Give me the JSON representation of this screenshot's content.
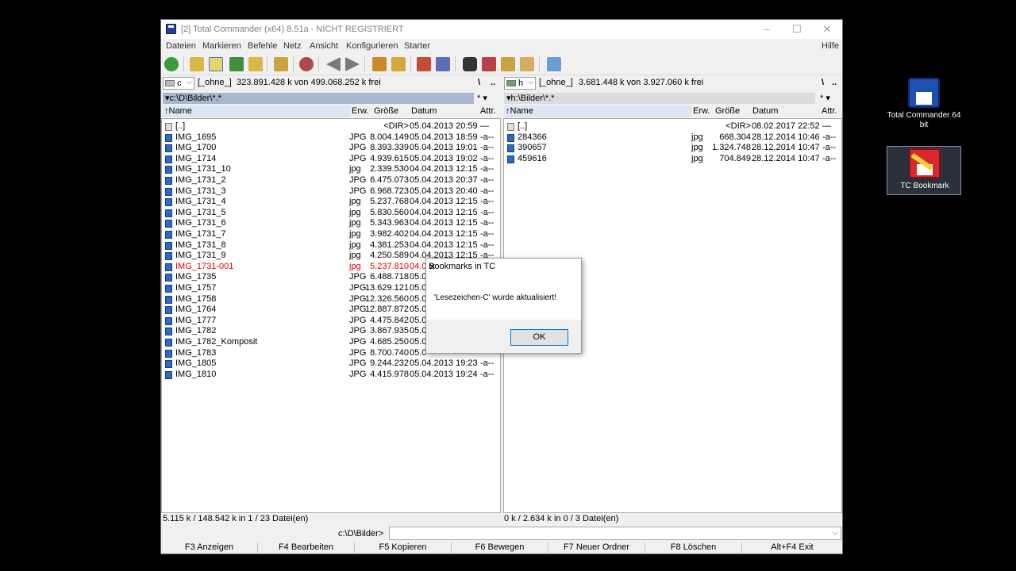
{
  "window": {
    "title": "[2] Total Commander (x64) 8.51a - NICHT REGISTRIERT",
    "controls": [
      "–",
      "☐",
      "✕"
    ]
  },
  "menu": [
    "Dateien",
    "Markieren",
    "Befehle",
    "Netz",
    "Ansicht",
    "Konfigurieren",
    "Starter"
  ],
  "menu_help": "Hilfe",
  "left": {
    "drive": "c",
    "volume": "[_ohne_]",
    "free": "323.891.428 k von 499.068.252 k frei",
    "root_btn": "\\",
    "up_btn": "..",
    "path": "▾c:\\D\\Bilder\\*.*",
    "path_tail": "* ▾",
    "headers": {
      "name": "↑Name",
      "ext": "Erw.",
      "size": "Größe",
      "date": "Datum",
      "attr": "Attr."
    },
    "files": [
      {
        "name": "[..]",
        "ext": "",
        "size": "<DIR>",
        "date": "05.04.2013 20:59",
        "attr": "—",
        "up": true
      },
      {
        "name": "IMG_1695",
        "ext": "JPG",
        "size": "8.004.149",
        "date": "05.04.2013 18:59",
        "attr": "-a--"
      },
      {
        "name": "IMG_1700",
        "ext": "JPG",
        "size": "8.393.339",
        "date": "05.04.2013 19:01",
        "attr": "-a--"
      },
      {
        "name": "IMG_1714",
        "ext": "JPG",
        "size": "4.939.615",
        "date": "05.04.2013 19:02",
        "attr": "-a--"
      },
      {
        "name": "IMG_1731_10",
        "ext": "jpg",
        "size": "2.339.530",
        "date": "04.04.2013 12:15",
        "attr": "-a--"
      },
      {
        "name": "IMG_1731_2",
        "ext": "JPG",
        "size": "6.475.073",
        "date": "05.04.2013 20:37",
        "attr": "-a--"
      },
      {
        "name": "IMG_1731_3",
        "ext": "JPG",
        "size": "6.968.723",
        "date": "05.04.2013 20:40",
        "attr": "-a--"
      },
      {
        "name": "IMG_1731_4",
        "ext": "jpg",
        "size": "5.237.768",
        "date": "04.04.2013 12:15",
        "attr": "-a--"
      },
      {
        "name": "IMG_1731_5",
        "ext": "jpg",
        "size": "5.830.560",
        "date": "04.04.2013 12:15",
        "attr": "-a--"
      },
      {
        "name": "IMG_1731_6",
        "ext": "jpg",
        "size": "5.343.963",
        "date": "04.04.2013 12:15",
        "attr": "-a--"
      },
      {
        "name": "IMG_1731_7",
        "ext": "jpg",
        "size": "3.982.402",
        "date": "04.04.2013 12:15",
        "attr": "-a--"
      },
      {
        "name": "IMG_1731_8",
        "ext": "jpg",
        "size": "4.381.253",
        "date": "04.04.2013 12:15",
        "attr": "-a--"
      },
      {
        "name": "IMG_1731_9",
        "ext": "jpg",
        "size": "4.250.589",
        "date": "04.04.2013 12:15",
        "attr": "-a--"
      },
      {
        "name": "IMG_1731-001",
        "ext": "jpg",
        "size": "5.237.810",
        "date": "04.0",
        "attr": "",
        "selected": true
      },
      {
        "name": "IMG_1735",
        "ext": "JPG",
        "size": "6.488.718",
        "date": "05.0",
        "attr": ""
      },
      {
        "name": "IMG_1757",
        "ext": "JPG",
        "size": "13.629.121",
        "date": "05.0",
        "attr": ""
      },
      {
        "name": "IMG_1758",
        "ext": "JPG",
        "size": "12.326.560",
        "date": "05.0",
        "attr": ""
      },
      {
        "name": "IMG_1764",
        "ext": "JPG",
        "size": "12.887.872",
        "date": "05.0",
        "attr": ""
      },
      {
        "name": "IMG_1777",
        "ext": "JPG",
        "size": "4.475.842",
        "date": "05.0",
        "attr": ""
      },
      {
        "name": "IMG_1782",
        "ext": "JPG",
        "size": "3.867.935",
        "date": "05.0",
        "attr": ""
      },
      {
        "name": "IMG_1782_Komposit",
        "ext": "JPG",
        "size": "4.685.250",
        "date": "05.0",
        "attr": ""
      },
      {
        "name": "IMG_1783",
        "ext": "JPG",
        "size": "8.700.740",
        "date": "05.0",
        "attr": ""
      },
      {
        "name": "IMG_1805",
        "ext": "JPG",
        "size": "9.244.232",
        "date": "05.04.2013 19:23",
        "attr": "-a--"
      },
      {
        "name": "IMG_1810",
        "ext": "JPG",
        "size": "4.415.978",
        "date": "05.04.2013 19:24",
        "attr": "-a--"
      }
    ],
    "status": "5.115 k / 148.542 k in 1 / 23 Datei(en)"
  },
  "right": {
    "drive": "h",
    "volume": "[_ohne_]",
    "free": "3.681.448 k von 3.927.060 k frei",
    "root_btn": "\\",
    "up_btn": "..",
    "path": "▾h:\\Bilder\\*.*",
    "path_tail": "* ▾",
    "headers": {
      "name": "↑Name",
      "ext": "Erw.",
      "size": "Größe",
      "date": "Datum",
      "attr": "Attr."
    },
    "files": [
      {
        "name": "[..]",
        "ext": "",
        "size": "<DIR>",
        "date": "08.02.2017 22:52",
        "attr": "—",
        "up": true
      },
      {
        "name": "284366",
        "ext": "jpg",
        "size": "668.304",
        "date": "28.12.2014 10:46",
        "attr": "-a--"
      },
      {
        "name": "390657",
        "ext": "jpg",
        "size": "1.324.748",
        "date": "28.12.2014 10:47",
        "attr": "-a--"
      },
      {
        "name": "459616",
        "ext": "jpg",
        "size": "704.849",
        "date": "28.12.2014 10:47",
        "attr": "-a--"
      }
    ],
    "status": "0 k / 2.634 k in 0 / 3 Datei(en)"
  },
  "cmdline": {
    "label": "c:\\D\\Bilder>",
    "value": ""
  },
  "fkeys": [
    "F3 Anzeigen",
    "F4 Bearbeiten",
    "F5 Kopieren",
    "F6 Bewegen",
    "F7 Neuer Ordner",
    "F8 Löschen",
    "Alt+F4 Exit"
  ],
  "dialog": {
    "title": "Bookmarks in TC",
    "close": "✕",
    "message": "'Lesezeichen-C' wurde aktualisiert!",
    "ok": "OK"
  },
  "desktop": [
    {
      "label": "Total Commander 64 bit",
      "icon": "floppy-disk-icon"
    },
    {
      "label": "TC Bookmark",
      "icon": "bookmark-floppy-icon"
    }
  ],
  "colors": {
    "path_active": "#a8b7cf",
    "selected_file": "#e00000",
    "dialog_accent": "#0078d7"
  }
}
